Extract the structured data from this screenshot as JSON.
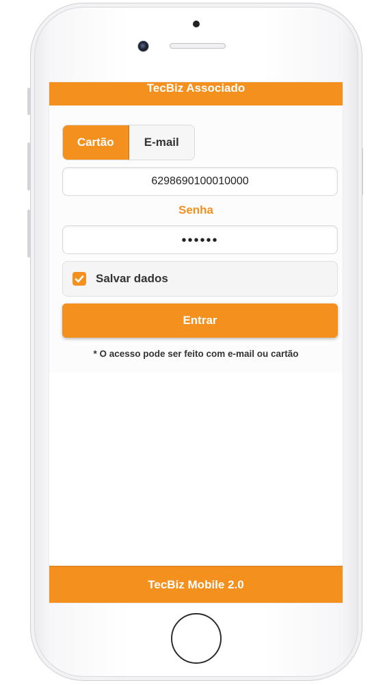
{
  "header": {
    "title": "TecBiz Associado"
  },
  "login_mode": {
    "options": [
      {
        "label": "Cartão",
        "selected": true
      },
      {
        "label": "E-mail",
        "selected": false
      }
    ]
  },
  "card_field": {
    "value": "6298690100010000"
  },
  "password": {
    "label": "Senha",
    "masked_value": "••••••"
  },
  "remember": {
    "label": "Salvar dados",
    "checked": true
  },
  "submit": {
    "label": "Entrar"
  },
  "hint": {
    "text": "* O acesso pode ser feito com e-mail ou cartão"
  },
  "footer": {
    "title": "TecBiz Mobile 2.0"
  },
  "colors": {
    "accent": "#f4901e",
    "text": "#333333",
    "background": "#ffffff"
  },
  "icons": {
    "remember_checkbox": "checkmark-icon"
  }
}
